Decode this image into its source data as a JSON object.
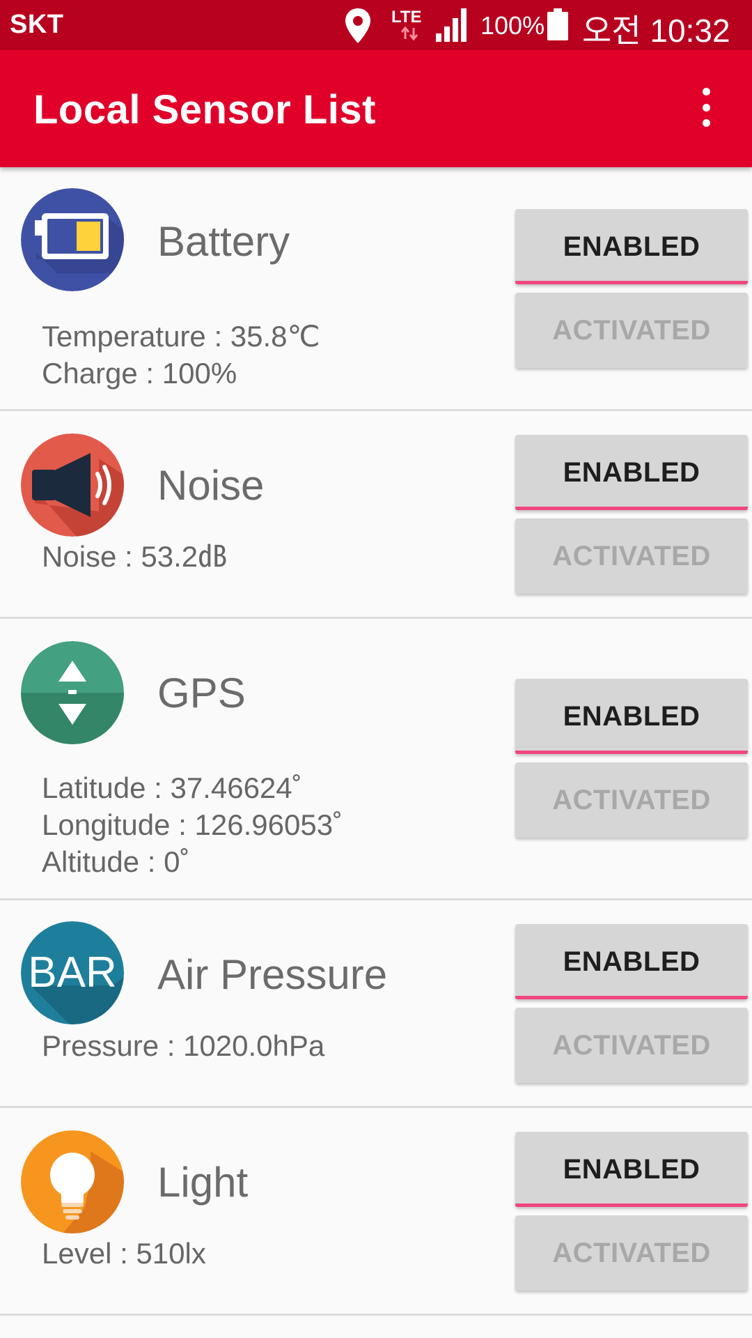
{
  "status_bar": {
    "carrier": "SKT",
    "network": "LTE",
    "battery_percent": "100%",
    "time": "오전 10:32"
  },
  "app_bar": {
    "title": "Local Sensor List"
  },
  "sensors": [
    {
      "name": "Battery",
      "icon": "battery-icon",
      "readings": [
        "Temperature : 35.8℃",
        "Charge : 100%"
      ],
      "enabled_label": "ENABLED",
      "activated_label": "ACTIVATED"
    },
    {
      "name": "Noise",
      "icon": "speaker-icon",
      "readings": [
        "Noise : 53.2㏈"
      ],
      "enabled_label": "ENABLED",
      "activated_label": "ACTIVATED"
    },
    {
      "name": "GPS",
      "icon": "gps-icon",
      "readings": [
        "Latitude : 37.46624˚",
        "Longitude : 126.96053˚",
        "Altitude : 0˚"
      ],
      "enabled_label": "ENABLED",
      "activated_label": "ACTIVATED"
    },
    {
      "name": "Air Pressure",
      "icon": "bar-icon",
      "icon_text": "BAR",
      "readings": [
        "Pressure : 1020.0hPa"
      ],
      "enabled_label": "ENABLED",
      "activated_label": "ACTIVATED"
    },
    {
      "name": "Light",
      "icon": "lightbulb-icon",
      "readings": [
        "Level : 510lx"
      ],
      "enabled_label": "ENABLED",
      "activated_label": "ACTIVATED"
    }
  ],
  "colors": {
    "status_bar": "#b8001f",
    "app_bar": "#e0002a",
    "enabled_accent": "#f0467e",
    "battery_icon_bg": "#3f51a5",
    "noise_icon_bg": "#e25a4a",
    "gps_icon_bg": "#43a080",
    "bar_icon_bg": "#1e7f9c",
    "light_icon_bg": "#f6961e"
  }
}
